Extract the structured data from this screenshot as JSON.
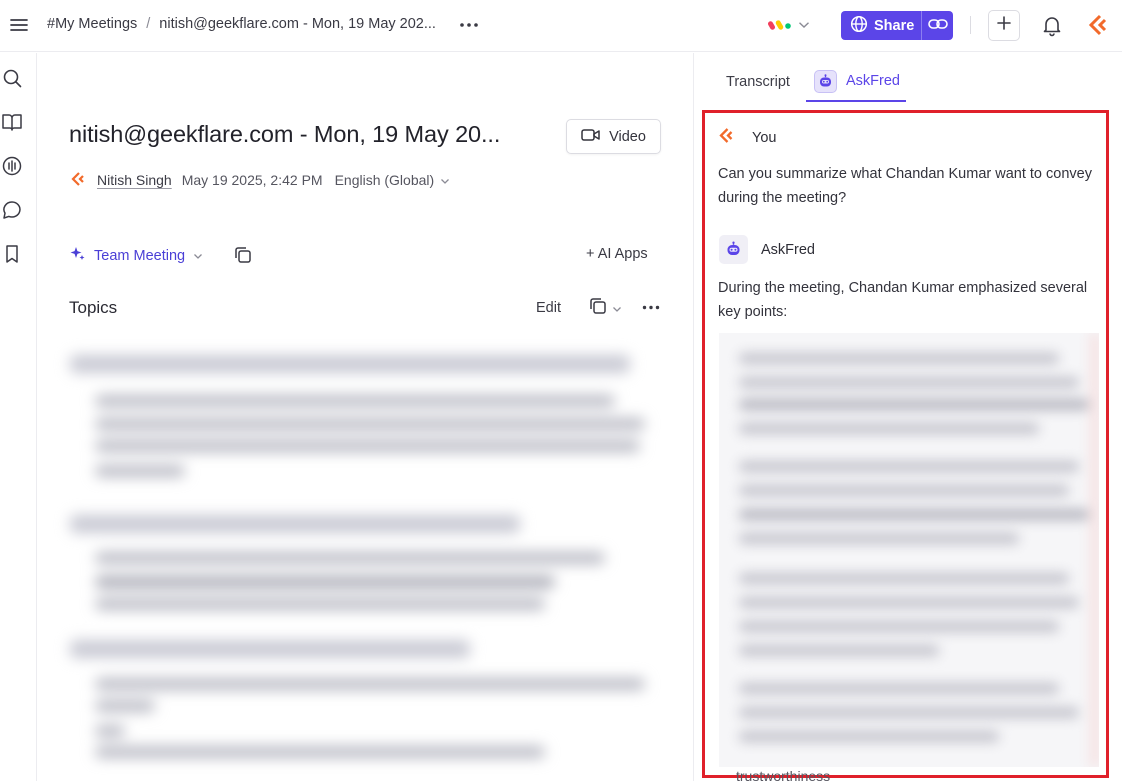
{
  "header": {
    "breadcrumb_root": "#My Meetings",
    "breadcrumb_separator": "/",
    "breadcrumb_current": "nitish@geekflare.com - Mon, 19 May 202...",
    "share_label": "Share"
  },
  "meeting": {
    "title": "nitish@geekflare.com - Mon, 19 May 20...",
    "video_label": "Video",
    "owner": "Nitish Singh",
    "date": "May 19 2025, 2:42 PM",
    "language": "English (Global)",
    "template": "Team Meeting",
    "ai_apps_label": "+ AI Apps",
    "topics_heading": "Topics",
    "edit_label": "Edit"
  },
  "panel": {
    "tabs": [
      {
        "label": "Transcript",
        "active": false
      },
      {
        "label": "AskFred",
        "active": true
      }
    ],
    "chat": {
      "user_name": "You",
      "question": "Can you summarize what Chandan Kumar want to convey during the meeting?",
      "bot_name": "AskFred",
      "answer_intro": "During the meeting, Chandan Kumar emphasized several key points:",
      "trailing_text": "trustworthiness"
    }
  },
  "colors": {
    "accent": "#5b45e8",
    "brand_orange": "#f26a2b",
    "highlight_frame": "#e0202a"
  },
  "icons": [
    "menu-icon",
    "more-icon",
    "monday-logo-icon",
    "globe-icon",
    "link-icon",
    "plus-icon",
    "bell-icon",
    "fireflies-logo-icon",
    "search-icon",
    "book-icon",
    "analytics-icon",
    "chat-icon",
    "bookmark-icon",
    "video-camera-icon",
    "sparkle-icon",
    "copy-icon",
    "robot-icon"
  ]
}
